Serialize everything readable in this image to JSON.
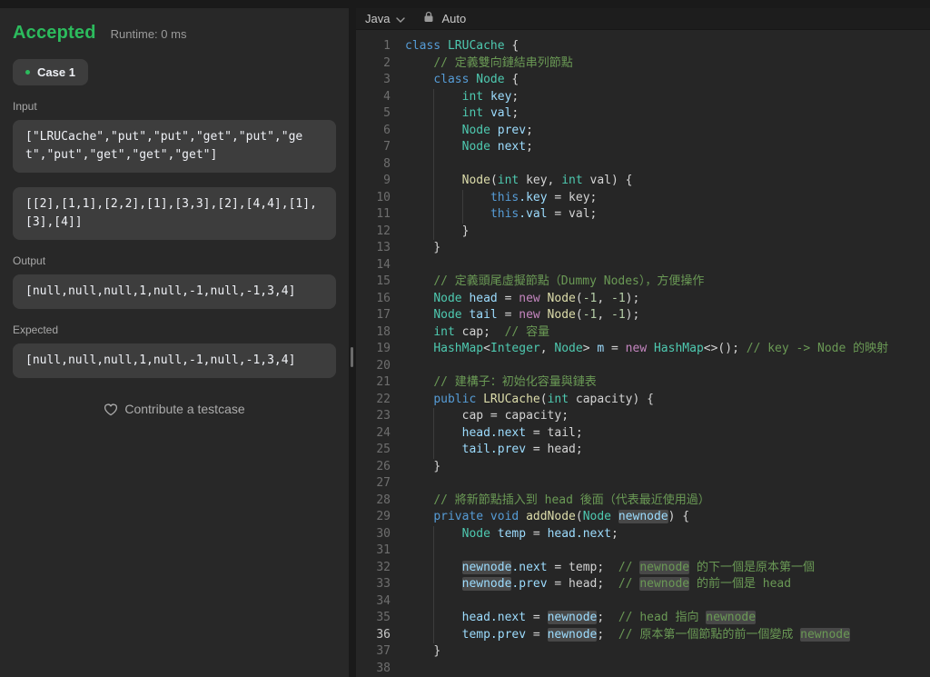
{
  "colors": {
    "accent_green": "#2cbb5d",
    "panel_bg": "#282828",
    "editor_bg": "#262626",
    "box_bg": "rgba(255,255,255,0.10)",
    "syntax": {
      "keyword": "#569cd6",
      "new_keyword": "#c586c0",
      "type": "#4ec9b0",
      "function": "#dcdcaa",
      "property": "#9cdcfe",
      "plain": "#d4d4d4",
      "number": "#b5cea8",
      "comment": "#6a9955"
    }
  },
  "result_panel": {
    "status": "Accepted",
    "runtime": "Runtime: 0 ms",
    "case_label": "Case 1",
    "input_label": "Input",
    "inputs": [
      "[\"LRUCache\",\"put\",\"put\",\"get\",\"put\",\"get\",\"put\",\"get\",\"get\",\"get\"]",
      "[[2],[1,1],[2,2],[1],[3,3],[2],[4,4],[1],[3],[4]]"
    ],
    "output_label": "Output",
    "output": "[null,null,null,1,null,-1,null,-1,3,4]",
    "expected_label": "Expected",
    "expected": "[null,null,null,1,null,-1,null,-1,3,4]",
    "contribute": "Contribute a testcase",
    "icons": {
      "heart": "heart-outline-icon",
      "case_dot": "green-dot"
    }
  },
  "editor": {
    "language": "Java",
    "mode": "Auto",
    "icons": {
      "chevron": "chevron-down-icon",
      "lock": "lock-icon"
    },
    "active_line": 36,
    "lines": [
      {
        "n": 1,
        "g": 0,
        "t": [
          [
            "kw",
            "class"
          ],
          [
            "pl",
            " "
          ],
          [
            "ty",
            "LRUCache"
          ],
          [
            "pl",
            " {"
          ]
        ]
      },
      {
        "n": 2,
        "g": 1,
        "t": [
          [
            "cm",
            "// 定義雙向鏈結串列節點"
          ]
        ]
      },
      {
        "n": 3,
        "g": 1,
        "t": [
          [
            "kw",
            "class"
          ],
          [
            "pl",
            " "
          ],
          [
            "ty",
            "Node"
          ],
          [
            "pl",
            " {"
          ]
        ]
      },
      {
        "n": 4,
        "g": 2,
        "t": [
          [
            "ty",
            "int"
          ],
          [
            "pl",
            " "
          ],
          [
            "pr",
            "key"
          ],
          [
            "pl",
            ";"
          ]
        ]
      },
      {
        "n": 5,
        "g": 2,
        "t": [
          [
            "ty",
            "int"
          ],
          [
            "pl",
            " "
          ],
          [
            "pr",
            "val"
          ],
          [
            "pl",
            ";"
          ]
        ]
      },
      {
        "n": 6,
        "g": 2,
        "t": [
          [
            "ty",
            "Node"
          ],
          [
            "pl",
            " "
          ],
          [
            "pr",
            "prev"
          ],
          [
            "pl",
            ";"
          ]
        ]
      },
      {
        "n": 7,
        "g": 2,
        "t": [
          [
            "ty",
            "Node"
          ],
          [
            "pl",
            " "
          ],
          [
            "pr",
            "next"
          ],
          [
            "pl",
            ";"
          ]
        ]
      },
      {
        "n": 8,
        "g": 2,
        "t": []
      },
      {
        "n": 9,
        "g": 2,
        "t": [
          [
            "fn",
            "Node"
          ],
          [
            "pl",
            "("
          ],
          [
            "ty",
            "int"
          ],
          [
            "pl",
            " key, "
          ],
          [
            "ty",
            "int"
          ],
          [
            "pl",
            " val) {"
          ]
        ]
      },
      {
        "n": 10,
        "g": 3,
        "t": [
          [
            "kw",
            "this"
          ],
          [
            "pr",
            ".key"
          ],
          [
            "pl",
            " = key;"
          ]
        ]
      },
      {
        "n": 11,
        "g": 3,
        "t": [
          [
            "kw",
            "this"
          ],
          [
            "pr",
            ".val"
          ],
          [
            "pl",
            " = val;"
          ]
        ]
      },
      {
        "n": 12,
        "g": 2,
        "t": [
          [
            "pl",
            "}"
          ]
        ]
      },
      {
        "n": 13,
        "g": 1,
        "t": [
          [
            "pl",
            "}"
          ]
        ]
      },
      {
        "n": 14,
        "g": 1,
        "t": []
      },
      {
        "n": 15,
        "g": 1,
        "t": [
          [
            "cm",
            "// 定義頭尾虛擬節點（Dummy Nodes），方便操作"
          ]
        ]
      },
      {
        "n": 16,
        "g": 1,
        "t": [
          [
            "ty",
            "Node"
          ],
          [
            "pr",
            " head"
          ],
          [
            "pl",
            " = "
          ],
          [
            "nw",
            "new"
          ],
          [
            "fn",
            " Node"
          ],
          [
            "pl",
            "("
          ],
          [
            "nu",
            "-1"
          ],
          [
            "pl",
            ", "
          ],
          [
            "nu",
            "-1"
          ],
          [
            "pl",
            ");"
          ]
        ]
      },
      {
        "n": 17,
        "g": 1,
        "t": [
          [
            "ty",
            "Node"
          ],
          [
            "pr",
            " tail"
          ],
          [
            "pl",
            " = "
          ],
          [
            "nw",
            "new"
          ],
          [
            "fn",
            " Node"
          ],
          [
            "pl",
            "("
          ],
          [
            "nu",
            "-1"
          ],
          [
            "pl",
            ", "
          ],
          [
            "nu",
            "-1"
          ],
          [
            "pl",
            ");"
          ]
        ]
      },
      {
        "n": 18,
        "g": 1,
        "t": [
          [
            "ty",
            "int"
          ],
          [
            "pl",
            " cap;  "
          ],
          [
            "cm",
            "// 容量"
          ]
        ]
      },
      {
        "n": 19,
        "g": 1,
        "t": [
          [
            "ty",
            "HashMap"
          ],
          [
            "pl",
            "<"
          ],
          [
            "ty",
            "Integer"
          ],
          [
            "pl",
            ", "
          ],
          [
            "ty",
            "Node"
          ],
          [
            "pl",
            "> "
          ],
          [
            "pr",
            "m"
          ],
          [
            "pl",
            " = "
          ],
          [
            "nw",
            "new"
          ],
          [
            "ty",
            " HashMap"
          ],
          [
            "pl",
            "<>(); "
          ],
          [
            "cm",
            "// key -> Node 的映射"
          ]
        ]
      },
      {
        "n": 20,
        "g": 1,
        "t": []
      },
      {
        "n": 21,
        "g": 1,
        "t": [
          [
            "cm",
            "// 建構子：初始化容量與鏈表"
          ]
        ]
      },
      {
        "n": 22,
        "g": 1,
        "t": [
          [
            "kw",
            "public"
          ],
          [
            "fn",
            " LRUCache"
          ],
          [
            "pl",
            "("
          ],
          [
            "ty",
            "int"
          ],
          [
            "pl",
            " capacity) {"
          ]
        ]
      },
      {
        "n": 23,
        "g": 2,
        "t": [
          [
            "pl",
            "cap = capacity;"
          ]
        ]
      },
      {
        "n": 24,
        "g": 2,
        "t": [
          [
            "pr",
            "head.next"
          ],
          [
            "pl",
            " = tail;"
          ]
        ]
      },
      {
        "n": 25,
        "g": 2,
        "t": [
          [
            "pr",
            "tail.prev"
          ],
          [
            "pl",
            " = head;"
          ]
        ]
      },
      {
        "n": 26,
        "g": 1,
        "t": [
          [
            "pl",
            "}"
          ]
        ]
      },
      {
        "n": 27,
        "g": 1,
        "t": []
      },
      {
        "n": 28,
        "g": 1,
        "t": [
          [
            "cm",
            "// 將新節點插入到 head 後面（代表最近使用過）"
          ]
        ]
      },
      {
        "n": 29,
        "g": 1,
        "t": [
          [
            "kw",
            "private"
          ],
          [
            "kw",
            " void"
          ],
          [
            "fn",
            " addNode"
          ],
          [
            "pl",
            "("
          ],
          [
            "ty",
            "Node"
          ],
          [
            "pl",
            " "
          ],
          [
            "hl",
            "newnode"
          ],
          [
            "pl",
            ") {"
          ]
        ]
      },
      {
        "n": 30,
        "g": 2,
        "t": [
          [
            "ty",
            "Node"
          ],
          [
            "pr",
            " temp"
          ],
          [
            "pl",
            " = "
          ],
          [
            "pr",
            "head.next"
          ],
          [
            "pl",
            ";"
          ]
        ]
      },
      {
        "n": 31,
        "g": 2,
        "t": []
      },
      {
        "n": 32,
        "g": 2,
        "t": [
          [
            "hl",
            "newnode"
          ],
          [
            "pr",
            ".next"
          ],
          [
            "pl",
            " = temp;  "
          ],
          [
            "cm",
            "// "
          ],
          [
            "hc",
            "newnode"
          ],
          [
            "cm",
            " 的下一個是原本第一個"
          ]
        ]
      },
      {
        "n": 33,
        "g": 2,
        "t": [
          [
            "hl",
            "newnode"
          ],
          [
            "pr",
            ".prev"
          ],
          [
            "pl",
            " = head;  "
          ],
          [
            "cm",
            "// "
          ],
          [
            "hc",
            "newnode"
          ],
          [
            "cm",
            " 的前一個是 head"
          ]
        ]
      },
      {
        "n": 34,
        "g": 2,
        "t": []
      },
      {
        "n": 35,
        "g": 2,
        "t": [
          [
            "pr",
            "head.next"
          ],
          [
            "pl",
            " = "
          ],
          [
            "hl",
            "newnode"
          ],
          [
            "pl",
            ";  "
          ],
          [
            "cm",
            "// head 指向 "
          ],
          [
            "hc",
            "newnode"
          ]
        ]
      },
      {
        "n": 36,
        "g": 2,
        "t": [
          [
            "pr",
            "temp.prev"
          ],
          [
            "pl",
            " = "
          ],
          [
            "hl",
            "newnode"
          ],
          [
            "pl",
            ";  "
          ],
          [
            "cm",
            "// 原本第一個節點的前一個變成 "
          ],
          [
            "hc",
            "newnode"
          ]
        ]
      },
      {
        "n": 37,
        "g": 1,
        "t": [
          [
            "pl",
            "}"
          ]
        ]
      },
      {
        "n": 38,
        "g": 0,
        "t": []
      }
    ]
  }
}
